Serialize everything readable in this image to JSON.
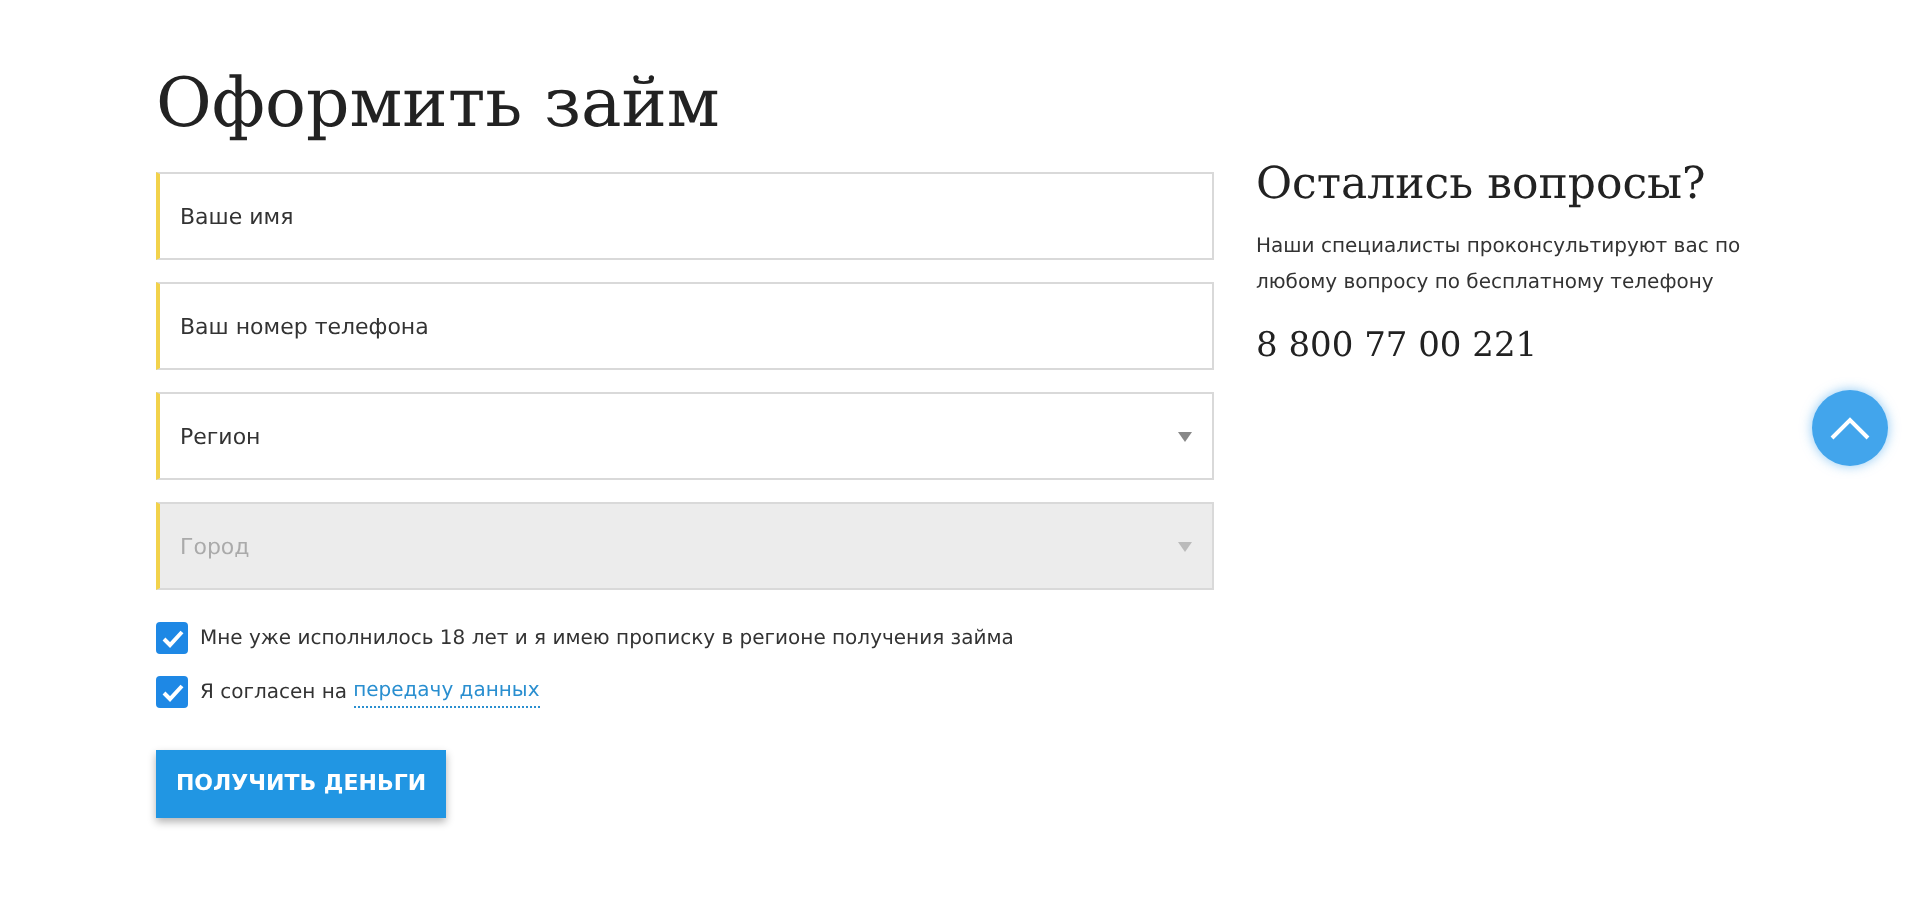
{
  "title": "Оформить займ",
  "fields": [
    {
      "kind": "text",
      "placeholder": "Ваше имя",
      "disabled": false
    },
    {
      "kind": "text",
      "placeholder": "Ваш номер телефона",
      "disabled": false
    },
    {
      "kind": "select",
      "placeholder": "Регион",
      "disabled": false
    },
    {
      "kind": "select",
      "placeholder": "Город",
      "disabled": true
    }
  ],
  "checkboxes": [
    {
      "label": "Мне уже исполнилось 18 лет и я имею прописку в регионе получения займа",
      "checked": true
    },
    {
      "label": "Я согласен на",
      "link": "передачу данных",
      "checked": true
    }
  ],
  "submit_button": "ПОЛУЧИТЬ ДЕНЬГИ",
  "sidebar": {
    "heading": "Остались вопросы?",
    "text": "Наши специалисты проконсультируют вас по любому вопросу по бесплатному телефону",
    "phone": "8 800 77 00 221"
  }
}
